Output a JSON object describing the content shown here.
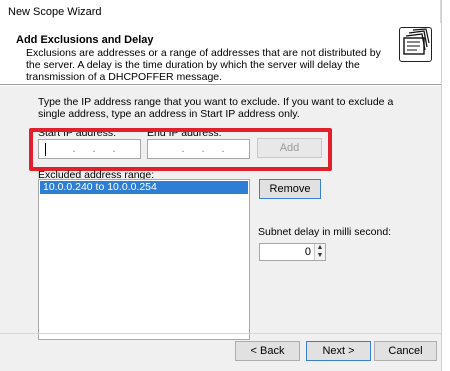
{
  "window": {
    "title": "New Scope Wizard"
  },
  "header": {
    "title": "Add Exclusions and Delay",
    "description": "Exclusions are addresses or a range of addresses that are not distributed by the server. A delay is the time duration by which the server will delay the transmission of a DHCPOFFER message.",
    "icon": "folder-stack-icon"
  },
  "instruction": "Type the IP address range that you want to exclude. If you want to exclude a single address, type an address in Start IP address only.",
  "range": {
    "start_label": "Start IP address:",
    "start_value": "",
    "end_label": "End IP address:",
    "end_value": "",
    "add_label": "Add"
  },
  "excluded": {
    "label": "Excluded address range:",
    "items": [
      "10.0.0.240 to 10.0.0.254"
    ]
  },
  "remove_label": "Remove",
  "delay": {
    "label": "Subnet delay in milli second:",
    "value": "0"
  },
  "footer": {
    "back_label": "< Back",
    "next_label": "Next >",
    "cancel_label": "Cancel"
  },
  "colors": {
    "highlight": "#e0202a",
    "selection": "#2e7ed6",
    "focus_border": "#3c7fd0"
  }
}
